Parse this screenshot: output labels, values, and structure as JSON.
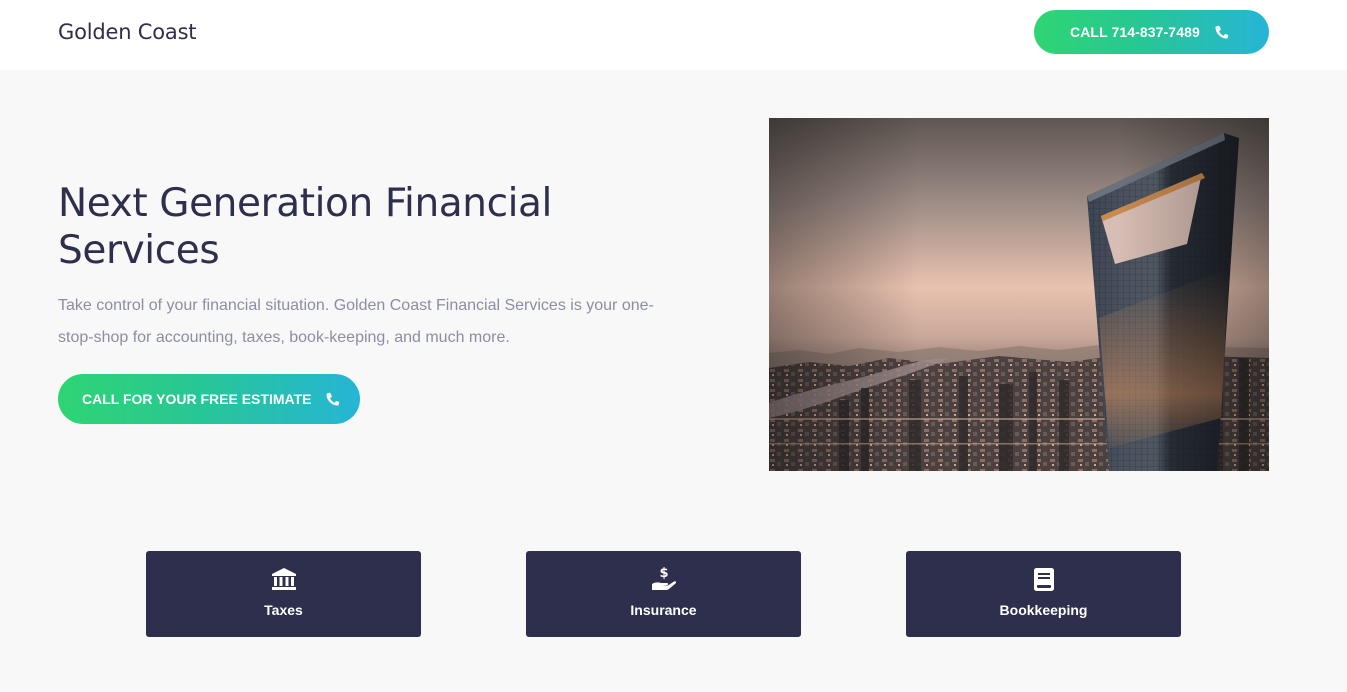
{
  "header": {
    "brand": "Golden Coast",
    "call_button": {
      "label": "CALL 714-837-7489",
      "icon": "phone-icon"
    }
  },
  "hero": {
    "title": "Next Generation Financial Services",
    "description": "Take control of your financial situation. Golden Coast Financial Services is your one-stop-shop for accounting, taxes, book-keeping, and much more.",
    "cta": {
      "label": "CALL FOR YOUR FREE ESTIMATE",
      "icon": "phone-icon"
    },
    "image": "city-skyline-skyscraper-at-sunset"
  },
  "services": [
    {
      "label": "Taxes",
      "icon": "bank-icon"
    },
    {
      "label": "Insurance",
      "icon": "hand-holding-dollar-icon"
    },
    {
      "label": "Bookkeeping",
      "icon": "book-icon"
    }
  ],
  "colors": {
    "accent_start": "#2ed573",
    "accent_end": "#26b5d6",
    "navy": "#2d2f4d",
    "muted_text": "#8b8ea4",
    "page_bg": "#f8f8f9"
  }
}
